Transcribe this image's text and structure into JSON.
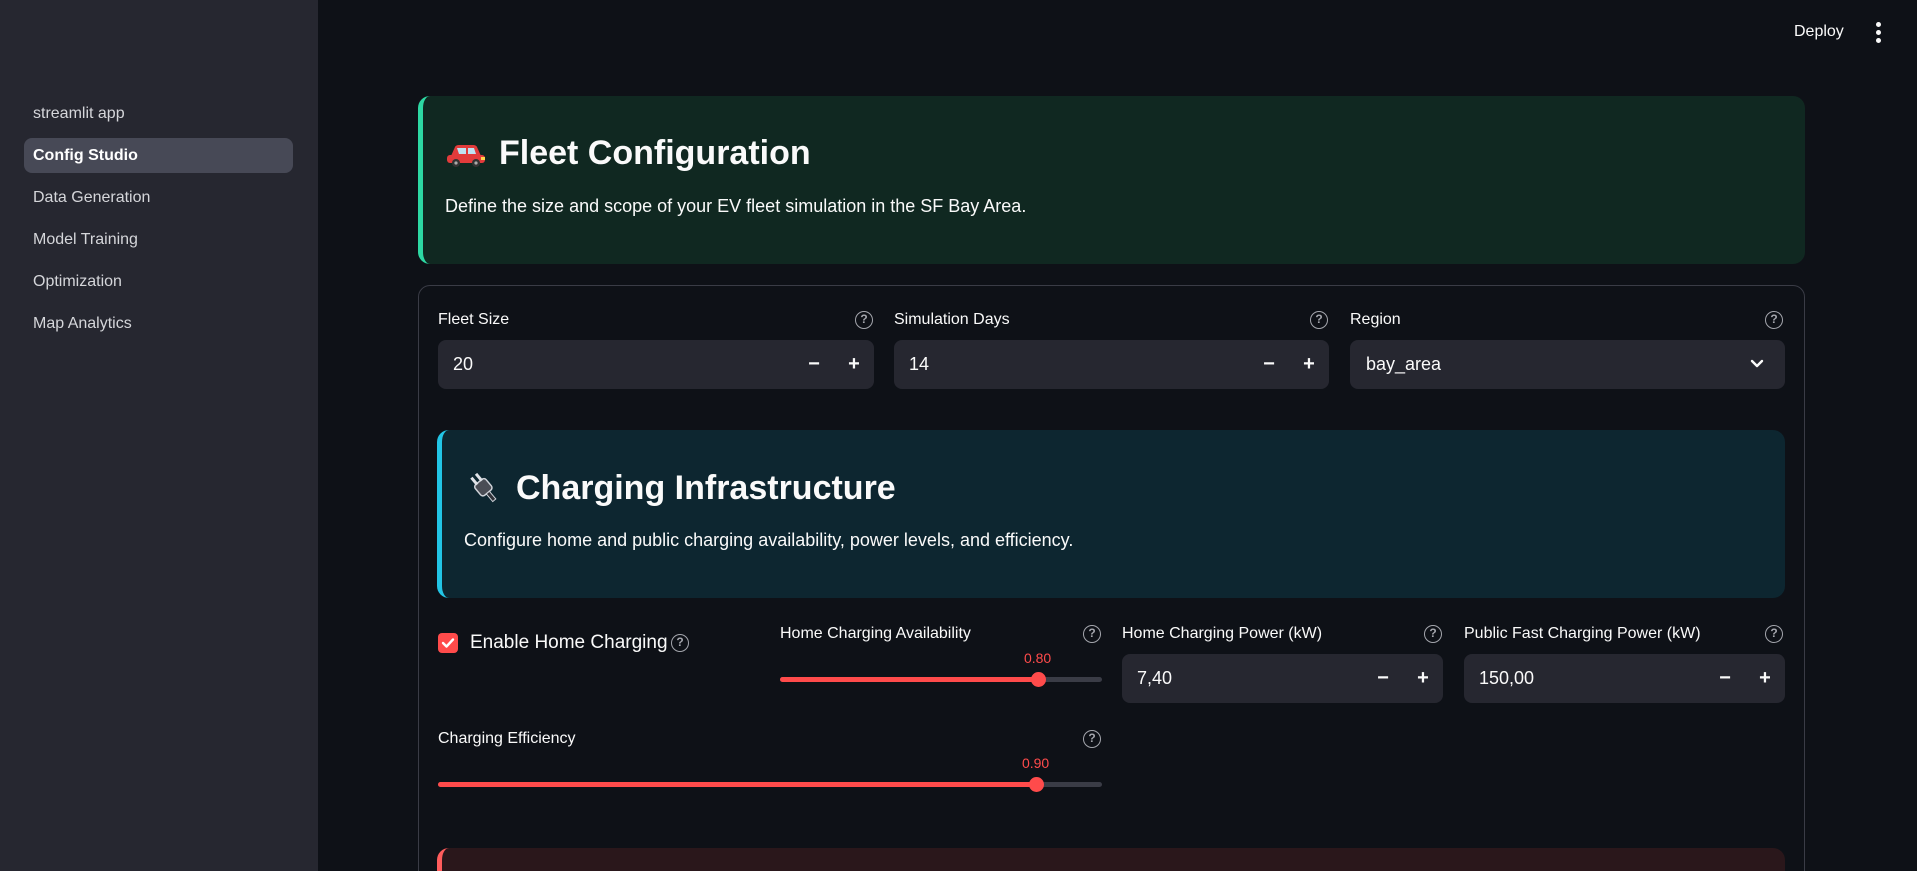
{
  "sidebar": {
    "items": [
      {
        "label": "streamlit app",
        "active": false
      },
      {
        "label": "Config Studio",
        "active": true
      },
      {
        "label": "Data Generation",
        "active": false
      },
      {
        "label": "Model Training",
        "active": false
      },
      {
        "label": "Optimization",
        "active": false
      },
      {
        "label": "Map Analytics",
        "active": false
      }
    ]
  },
  "topbar": {
    "deploy_label": "Deploy",
    "menu_icon": "kebab-menu-icon"
  },
  "fleet_section": {
    "icon": "car-icon",
    "title": "Fleet Configuration",
    "description": "Define the size and scope of your EV fleet simulation in the SF Bay Area.",
    "accent_color": "#2dd8a3"
  },
  "fields": {
    "fleet_size": {
      "label": "Fleet Size",
      "value": "20"
    },
    "simulation_days": {
      "label": "Simulation Days",
      "value": "14"
    },
    "region": {
      "label": "Region",
      "value": "bay_area"
    }
  },
  "charging_section": {
    "icon": "plug-icon",
    "title": "Charging Infrastructure",
    "description": "Configure home and public charging availability, power levels, and efficiency.",
    "accent_color": "#22c5e6"
  },
  "charging": {
    "enable_home": {
      "label": "Enable Home Charging",
      "checked": true
    },
    "home_availability": {
      "label": "Home Charging Availability",
      "value": "0.80",
      "fraction": 0.8
    },
    "home_power": {
      "label": "Home Charging Power (kW)",
      "value": "7,40"
    },
    "public_fast_power": {
      "label": "Public Fast Charging Power (kW)",
      "value": "150,00"
    },
    "efficiency": {
      "label": "Charging Efficiency",
      "value": "0.90",
      "fraction": 0.9
    }
  },
  "controls": {
    "minus": "−",
    "plus": "+",
    "help": "?"
  },
  "colors": {
    "primary": "#ff4b4b",
    "background": "#0e1117",
    "sidebar": "#262730"
  }
}
